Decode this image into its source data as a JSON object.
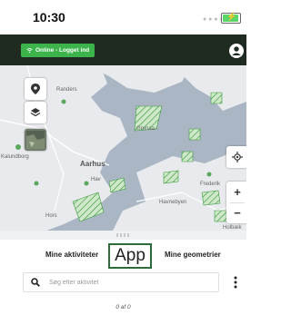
{
  "status_bar": {
    "time": "10:30",
    "signal_icon": "signal-dots-icon",
    "battery_icon": "battery-charging-icon"
  },
  "header": {
    "online_label": "Online - Logget ind",
    "online_icon": "wifi-icon",
    "profile_icon": "avatar-icon"
  },
  "map": {
    "place_labels": {
      "randers": "Randers",
      "aarhus": "Aarhus",
      "grenaa": "Grenaa",
      "kalundborg": "Kalundborg",
      "horsens": "Hors",
      "hav": "Hav",
      "havnebyen": "Havnebyen",
      "frederiksvaerk": "Frederik",
      "holbaek": "Holbæk"
    },
    "controls": [
      "location-pin-icon",
      "layers-icon",
      "satellite-thumbnail",
      "locate-me-icon",
      "zoom-in-button",
      "zoom-out-button"
    ],
    "zoom_in_label": "+",
    "zoom_out_label": "−",
    "colors": {
      "land": "#e8eaed",
      "water": "#aab6c4",
      "hatched_area": "#3a9a3e",
      "road": "#ffffff"
    }
  },
  "tabs": {
    "activities": "Mine aktiviteter",
    "geometries": "Mine geometrier"
  },
  "overlay_label": "App",
  "search": {
    "placeholder": "Søg efter aktivitet",
    "value": ""
  },
  "list": {
    "count_text": "0 af 0"
  }
}
